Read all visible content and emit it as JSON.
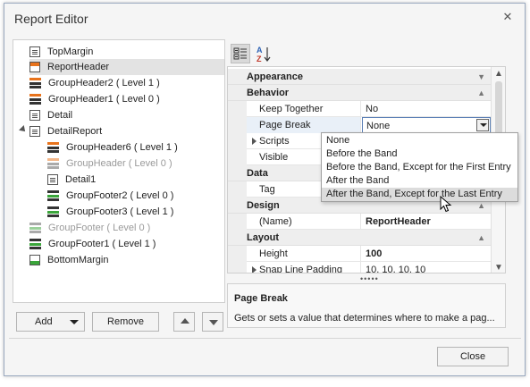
{
  "window": {
    "title": "Report Editor"
  },
  "tree": {
    "items": [
      {
        "label": "TopMargin",
        "icon": "top-margin-band-icon"
      },
      {
        "label": "ReportHeader",
        "icon": "report-header-band-icon",
        "selected": true
      },
      {
        "label": "GroupHeader2 ( Level 1 )",
        "icon": "group-header-band-icon"
      },
      {
        "label": "GroupHeader1 ( Level 0 )",
        "icon": "group-header-band-icon"
      },
      {
        "label": "Detail",
        "icon": "detail-band-icon"
      },
      {
        "label": "DetailReport",
        "icon": "detail-report-band-icon",
        "expanded": true
      },
      {
        "label": "GroupHeader6 ( Level 1 )",
        "icon": "group-header-band-icon"
      },
      {
        "label": "GroupHeader ( Level 0 )",
        "icon": "group-header-band-icon",
        "disabled": true
      },
      {
        "label": "Detail1",
        "icon": "detail-band-icon"
      },
      {
        "label": "GroupFooter2 ( Level 0 )",
        "icon": "group-footer-band-icon"
      },
      {
        "label": "GroupFooter3 ( Level 1 )",
        "icon": "group-footer-band-icon"
      },
      {
        "label": "GroupFooter ( Level 0 )",
        "icon": "group-footer-band-icon",
        "disabled": true
      },
      {
        "label": "GroupFooter1 ( Level 1 )",
        "icon": "group-footer-band-icon"
      },
      {
        "label": "BottomMargin",
        "icon": "bottom-margin-band-icon"
      }
    ]
  },
  "buttons": {
    "add": "Add",
    "remove": "Remove",
    "close": "Close"
  },
  "property_grid": {
    "categories": {
      "appearance": "Appearance",
      "behavior": "Behavior",
      "data": "Data",
      "design": "Design",
      "layout": "Layout"
    },
    "props": {
      "keep_together": {
        "name": "Keep Together",
        "value": "No"
      },
      "page_break": {
        "name": "Page Break",
        "value": "None"
      },
      "scripts": {
        "name": "Scripts"
      },
      "visible": {
        "name": "Visible"
      },
      "tag": {
        "name": "Tag"
      },
      "name": {
        "name": "(Name)",
        "value": "ReportHeader"
      },
      "height": {
        "name": "Height",
        "value": "100"
      },
      "snap_line_padding": {
        "name": "Snap Line Padding",
        "value": "10, 10, 10, 10"
      }
    },
    "dropdown_options": [
      "None",
      "Before the Band",
      "Before the Band, Except for the First Entry",
      "After the Band",
      "After the Band, Except for the Last Entry"
    ],
    "highlighted_option": "After the Band, Except for the Last Entry"
  },
  "description": {
    "title": "Page Break",
    "text": "Gets or sets a value that determines where to make a pag..."
  }
}
